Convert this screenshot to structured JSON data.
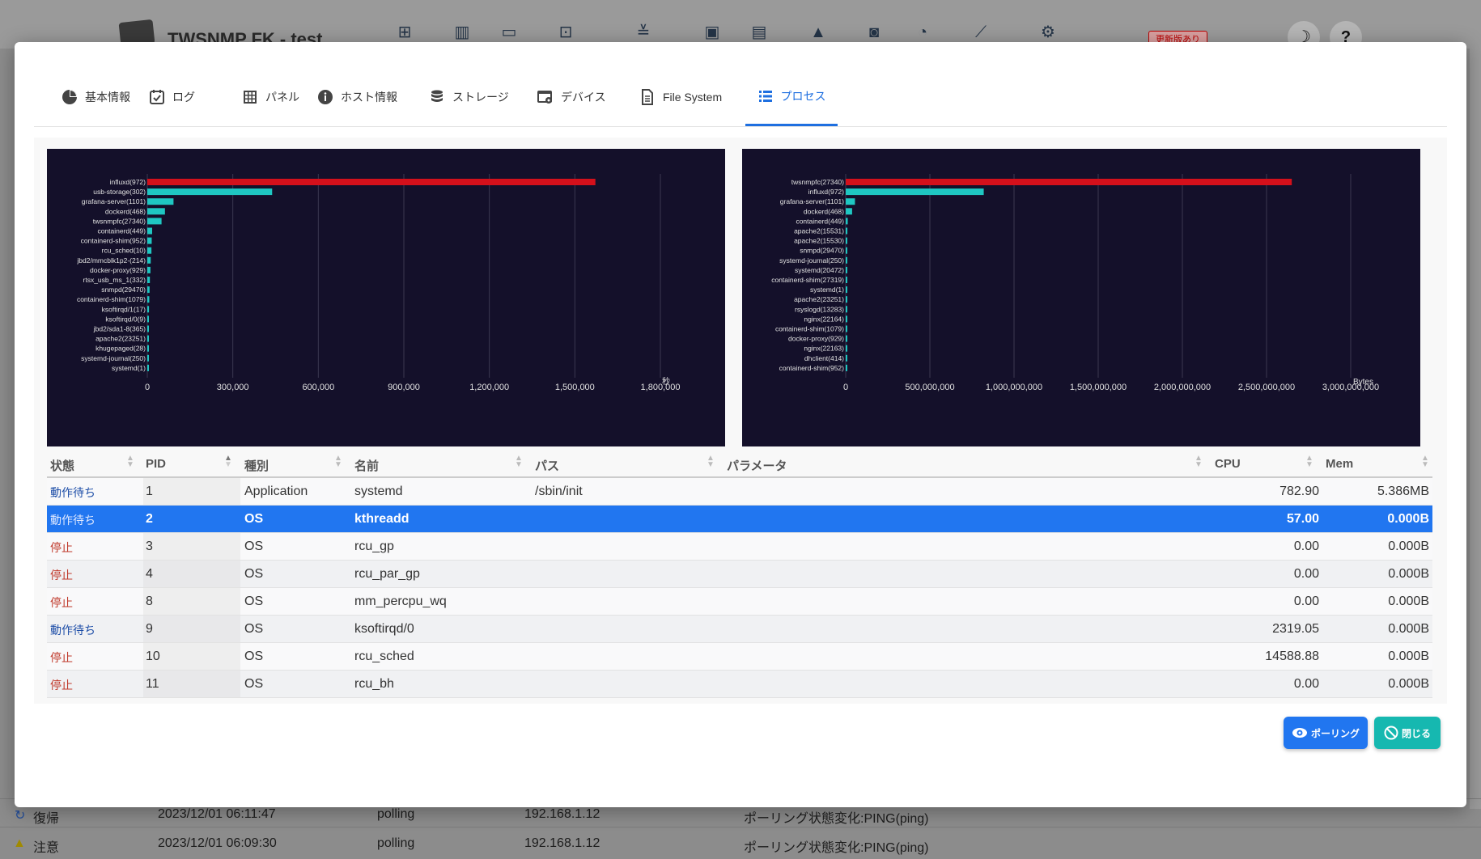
{
  "app": {
    "title": "TWSNMP FK - test",
    "update_badge": "更新版あり",
    "theme_icon": "☽",
    "help_icon": "?",
    "background_events": [
      {
        "level": "復帰",
        "time": "2023/12/01 06:11:47",
        "type": "polling",
        "ip": "192.168.1.12",
        "message": "ポーリング状態変化:PING(ping)"
      },
      {
        "level": "注意",
        "time": "2023/12/01 06:09:30",
        "type": "polling",
        "ip": "192.168.1.12",
        "message": "ポーリング状態変化:PING(ping)"
      }
    ]
  },
  "tabs": [
    {
      "label": "基本情報",
      "icon": "pie-chart-icon"
    },
    {
      "label": "ログ",
      "icon": "calendar-check-icon"
    },
    {
      "label": "パネル",
      "icon": "grid-icon"
    },
    {
      "label": "ホスト情報",
      "icon": "info-icon"
    },
    {
      "label": "ストレージ",
      "icon": "database-icon"
    },
    {
      "label": "デバイス",
      "icon": "device-icon"
    },
    {
      "label": "File System",
      "icon": "file-icon"
    },
    {
      "label": "プロセス",
      "icon": "list-icon",
      "active": true
    }
  ],
  "chart_data": [
    {
      "type": "bar",
      "orientation": "horizontal",
      "unit_label": "秒",
      "xlim": [
        0,
        1800000
      ],
      "xticks": [
        "0",
        "300,000",
        "600,000",
        "900,000",
        "1,200,000",
        "1,500,000",
        "1,800,000"
      ],
      "categories": [
        "influxd(972)",
        "usb-storage(302)",
        "grafana-server(1101)",
        "dockerd(468)",
        "twsnmpfc(27340)",
        "containerd(449)",
        "containerd-shim(952)",
        "rcu_sched(10)",
        "jbd2/mmcblk1p2-(214)",
        "docker-proxy(929)",
        "rtsx_usb_ms_1(332)",
        "snmpd(29470)",
        "containerd-shim(1079)",
        "ksoftirqd/1(17)",
        "ksoftirqd/0(9)",
        "jbd2/sda1-8(365)",
        "apache2(23251)",
        "khugepaged(28)",
        "systemd-journal(250)",
        "systemd(1)"
      ],
      "values": [
        1572000,
        438000,
        92000,
        62000,
        50000,
        17000,
        15500,
        14589,
        12000,
        11000,
        9000,
        8000,
        7000,
        6000,
        2319,
        1900,
        1600,
        1300,
        1000,
        783
      ],
      "colors": {
        "top": "#d4101b",
        "rest": "#1fc7c2",
        "background": "#14102a",
        "grid": "#3b3850",
        "text": "#e0e0e0"
      }
    },
    {
      "type": "bar",
      "orientation": "horizontal",
      "unit_label": "Bytes",
      "xlim": [
        0,
        3000000000
      ],
      "xticks": [
        "0",
        "500,000,000",
        "1,000,000,000",
        "1,500,000,000",
        "2,000,000,000",
        "2,500,000,000",
        "3,000,000,000"
      ],
      "categories": [
        "twsnmpfc(27340)",
        "influxd(972)",
        "grafana-server(1101)",
        "dockerd(468)",
        "containerd(449)",
        "apache2(15531)",
        "apache2(15530)",
        "snmpd(29470)",
        "systemd-journal(250)",
        "systemd(20472)",
        "containerd-shim(27319)",
        "systemd(1)",
        "apache2(23251)",
        "rsyslogd(13283)",
        "nginx(22164)",
        "containerd-shim(1079)",
        "docker-proxy(929)",
        "nginx(22163)",
        "dhclient(414)",
        "containerd-shim(952)"
      ],
      "values": [
        2650000000,
        820000000,
        55000000,
        38000000,
        12000000,
        10000000,
        9500000,
        9000000,
        8500000,
        8000000,
        7500000,
        7000000,
        6500000,
        6000000,
        5500000,
        5400000,
        5000000,
        4800000,
        4500000,
        4200000
      ],
      "colors": {
        "top": "#d4101b",
        "rest": "#1fc7c2",
        "background": "#14102a",
        "grid": "#3b3850",
        "text": "#e0e0e0"
      }
    }
  ],
  "table": {
    "headers": [
      "状態",
      "PID",
      "種別",
      "名前",
      "パス",
      "パラメータ",
      "CPU",
      "Mem"
    ],
    "rows": [
      {
        "state": "動作待ち",
        "pid": "1",
        "kind": "Application",
        "name": "systemd",
        "path": "/sbin/init",
        "params": "",
        "cpu": "782.90",
        "mem": "5.386MB"
      },
      {
        "state": "動作待ち",
        "pid": "2",
        "kind": "OS",
        "name": "kthreadd",
        "path": "",
        "params": "",
        "cpu": "57.00",
        "mem": "0.000B",
        "selected": true
      },
      {
        "state": "停止",
        "pid": "3",
        "kind": "OS",
        "name": "rcu_gp",
        "path": "",
        "params": "",
        "cpu": "0.00",
        "mem": "0.000B"
      },
      {
        "state": "停止",
        "pid": "4",
        "kind": "OS",
        "name": "rcu_par_gp",
        "path": "",
        "params": "",
        "cpu": "0.00",
        "mem": "0.000B"
      },
      {
        "state": "停止",
        "pid": "8",
        "kind": "OS",
        "name": "mm_percpu_wq",
        "path": "",
        "params": "",
        "cpu": "0.00",
        "mem": "0.000B"
      },
      {
        "state": "動作待ち",
        "pid": "9",
        "kind": "OS",
        "name": "ksoftirqd/0",
        "path": "",
        "params": "",
        "cpu": "2319.05",
        "mem": "0.000B"
      },
      {
        "state": "停止",
        "pid": "10",
        "kind": "OS",
        "name": "rcu_sched",
        "path": "",
        "params": "",
        "cpu": "14588.88",
        "mem": "0.000B"
      },
      {
        "state": "停止",
        "pid": "11",
        "kind": "OS",
        "name": "rcu_bh",
        "path": "",
        "params": "",
        "cpu": "0.00",
        "mem": "0.000B"
      }
    ]
  },
  "buttons": {
    "polling": {
      "label": "ポーリング",
      "color": "#2176f0"
    },
    "close": {
      "label": "閉じる",
      "color": "#16b8b0"
    }
  }
}
